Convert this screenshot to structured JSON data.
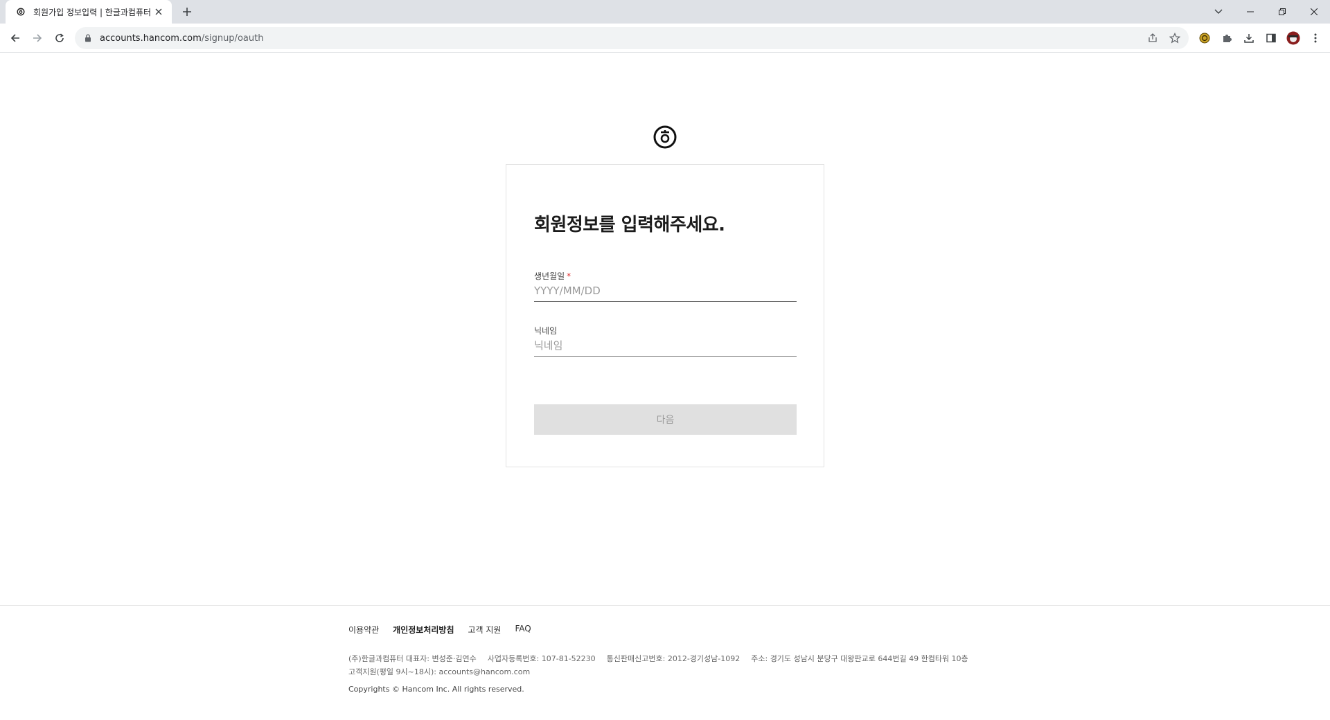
{
  "browser": {
    "tab_title": "회원가입 정보입력 | 한글과컴퓨터",
    "url_host": "accounts.hancom.com",
    "url_path": "/signup/oauth"
  },
  "page": {
    "title": "회원정보를 입력해주세요.",
    "birth_label": "생년월일",
    "birth_required_mark": "*",
    "birth_placeholder": "YYYY/MM/DD",
    "birth_value": "",
    "nickname_label": "닉네임",
    "nickname_placeholder": "닉네임",
    "nickname_value": "",
    "next_label": "다음"
  },
  "footer": {
    "links": [
      "이용약관",
      "개인정보처리방침",
      "고객 지원",
      "FAQ"
    ],
    "company": "(주)한글과컴퓨터 대표자: 변성준·김연수",
    "business_no": "사업자등록번호: 107-81-52230",
    "ecommerce_no": "통신판매신고번호: 2012-경기성남-1092",
    "address": "주소: 경기도 성남시 분당구 대왕판교로 644번길 49 한컴타워 10층",
    "support": "고객지원(평일 9시~18시): accounts@hancom.com",
    "copyright": "Copyrights © Hancom Inc. All rights reserved."
  },
  "colors": {
    "required": "#e03030",
    "button_disabled_bg": "#e0e0e0",
    "button_disabled_text": "#9c9c9c"
  }
}
